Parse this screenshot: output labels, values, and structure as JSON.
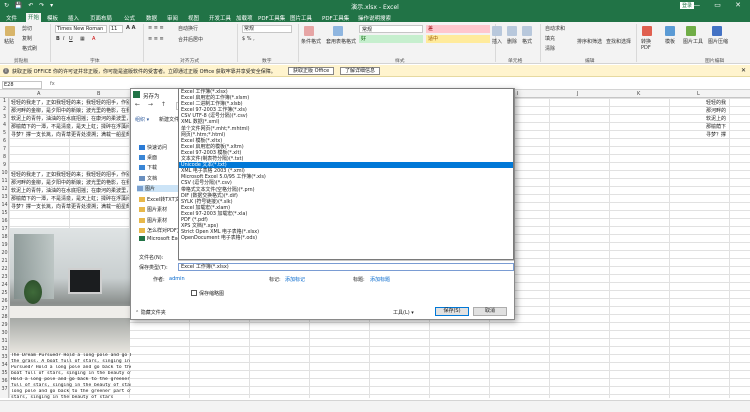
{
  "window": {
    "title": "演示.xlsx  -  Excel",
    "quick_access": "↻ 💾 ↶ ↷ ▾",
    "login_label": "登录",
    "controls": "— ▭ ✕"
  },
  "menu_tabs": [
    "文件",
    "开始",
    "模板",
    "插入",
    "页面布局",
    "公式",
    "数据",
    "审阅",
    "视图",
    "开发工具",
    "加载项",
    "PDF工具集",
    "图片工具",
    "PDF工具集",
    "操作说明搜索"
  ],
  "ribbon": {
    "clipboard": {
      "paste": "粘贴",
      "cut": "剪切",
      "copy": "复制",
      "format_painter": "格式刷",
      "group": "剪贴板"
    },
    "font": {
      "name": "Times New Roman",
      "size": "11",
      "group": "字体"
    },
    "alignment": {
      "wrap": "自动换行",
      "merge": "合并后居中",
      "group": "对齐方式"
    },
    "number": {
      "format": "常规",
      "group": "数字"
    },
    "styles": {
      "cond_format": "条件格式",
      "table_format": "套用表格格式",
      "normal": "常规",
      "bad": "差",
      "good": "好",
      "neutral": "适中",
      "group": "样式"
    },
    "cells": {
      "insert": "插入",
      "delete": "删除",
      "format": "格式",
      "group": "单元格"
    },
    "editing": {
      "autosum": "自动求和",
      "fill": "填充",
      "clear": "清除",
      "sort_filter": "排序和筛选",
      "find_select": "查找和选择",
      "group": "编辑"
    },
    "extra": {
      "convert_pdf": "转换PDF",
      "templates": "模板",
      "image_tools": "图片工具",
      "image_compress": "图片压缩",
      "image_group": "图片编辑"
    }
  },
  "notice": {
    "text": "获取正版 OFFICE   你的许可证并非正版，你可能是盗版软件的受害者。立即通过正版 Office 获取牢靠并享受安全保障。",
    "btn1": "获取正版 Office",
    "btn2": "了解详细信息"
  },
  "formula_bar": {
    "name_box": "E28",
    "fx": "fx"
  },
  "column_headers": [
    "A",
    "B",
    "C",
    "D",
    "E",
    "F",
    "G",
    "H",
    "I",
    "J",
    "K",
    "L",
    "M"
  ],
  "row_numbers": [
    "1",
    "2",
    "3",
    "4",
    "5",
    "6",
    "7",
    "8",
    "9",
    "10",
    "11",
    "12",
    "13",
    "14",
    "15",
    "16",
    "17",
    "18",
    "19",
    "20",
    "21",
    "22",
    "23",
    "24",
    "25",
    "26",
    "27",
    "28",
    "29",
    "30",
    "31",
    "32",
    "33",
    "34",
    "35",
    "36",
    "37"
  ],
  "cell_rows": [
    "轻轻的我走了，正如我轻轻的来；我轻轻的招手，作别西天的云彩。",
    "那河畔的金柳，是夕阳中的新娘；波光里的艳影，在我的心头荡漾。",
    "软泥上的青荇，油油的在水底招摇；在康河的柔波里，我甘心做一条水草！",
    "那榆荫下的一潭，不是清泉，是天上虹；揉碎在浮藻间，沉淀着彩虹似的梦。",
    "寻梦？撑一支长篙，向青草更青处漫溯；满载一船星辉，在星辉斑斓里放歌。",
    "",
    "",
    "",
    "",
    "轻轻的我走了，正如我轻轻的来；我轻轻的招手，作别西天的云彩。",
    "那河畔的金柳，是夕阳中的新娘；波光里的艳影，在我的心头荡漾。",
    "软泥上的青荇，油油的在水底招摇；在康河的柔波里，我甘心做一条水草！",
    "那榆荫下的一潭，不是清泉，是天上虹；揉碎在浮藻间，沉淀着彩虹似的梦。",
    "寻梦？撑一支长篙，向青草更青处漫溯；满载一船星辉，在星辉斑斓里放歌。"
  ],
  "right_cells": [
    "轻轻的我",
    "那河畔的",
    "软泥上的",
    "那榆荫下",
    "寻梦？撑"
  ],
  "english_text": [
    "The Dream Pursued? Hold a long pole and go back to the greener part of",
    "the grass. A boat full of stars, singing in the beauty of stars The Dream",
    "Pursued? Hold a long pole and go back to the greener part of the grass. A",
    "boat full of stars, singing in the beauty of stars The Dream Pursued?",
    "Hold a long pole and go back to the greener part of the grass. A boat",
    "full of stars, singing in the beauty of stars The Dream Pursued? Hold a",
    "long pole and go back to the greener part of the grass. A boat full of",
    "stars, singing in the beauty of stars"
  ],
  "dialog": {
    "title": "另存为",
    "nav_arrows": "← → ↑",
    "organize": "组织 ▾",
    "new_folder": "新建文件夹",
    "nav_items": [
      "快速访问",
      "桌面",
      "下载",
      "文档",
      "图片",
      "Excel转TXT文",
      "图片素材",
      "图片素材",
      "怎么样对PDF文件",
      "Microsoft Excel"
    ],
    "file_name_label": "文件名(N):",
    "file_type_label": "保存类型(T):",
    "file_type_value": "Excel 工作簿(*.xlsx)",
    "author_label": "作者:",
    "author_value": "admin",
    "tag_label": "标记:",
    "tag_value": "添加标记",
    "title_label": "标题:",
    "title_value": "添加标题",
    "thumbnail_label": "保存缩略图",
    "hide_folders": "隐藏文件夹",
    "tools": "工具(L) ▾",
    "save": "保存(S)",
    "cancel": "取消"
  },
  "file_types": [
    "Excel 工作簿(*.xlsx)",
    "Excel 启用宏的工作簿(*.xlsm)",
    "Excel 二进制工作簿(*.xlsb)",
    "Excel 97-2003 工作簿(*.xls)",
    "CSV UTF-8 (逗号分隔)(*.csv)",
    "XML 数据(*.xml)",
    "单个文件网页(*.mht;*.mhtml)",
    "网页(*.htm;*.html)",
    "Excel 模板(*.xltx)",
    "Excel 启用宏的模板(*.xltm)",
    "Excel 97-2003 模板(*.xlt)",
    "文本文件(制表符分隔)(*.txt)",
    "Unicode 文本(*.txt)",
    "XML 电子表格 2003 (*.xml)",
    "Microsoft Excel 5.0/95 工作簿(*.xls)",
    "CSV (逗号分隔)(*.csv)",
    "带格式文本文件(空格分隔)(*.prn)",
    "DIF (数据交换格式)(*.dif)",
    "SYLK (符号链接)(*.slk)",
    "Excel 加载宏(*.xlam)",
    "Excel 97-2003 加载宏(*.xla)",
    "PDF (*.pdf)",
    "XPS 文档(*.xps)",
    "Strict Open XML 电子表格(*.xlsx)",
    "OpenDocument 电子表格(*.ods)"
  ],
  "selected_file_type_index": 12,
  "colors": {
    "excel_green": "#217346",
    "selection_blue": "#0078d7",
    "bad_red": "#ffc7ce",
    "good_green": "#c6efce",
    "neutral_yellow": "#ffeb9c"
  }
}
